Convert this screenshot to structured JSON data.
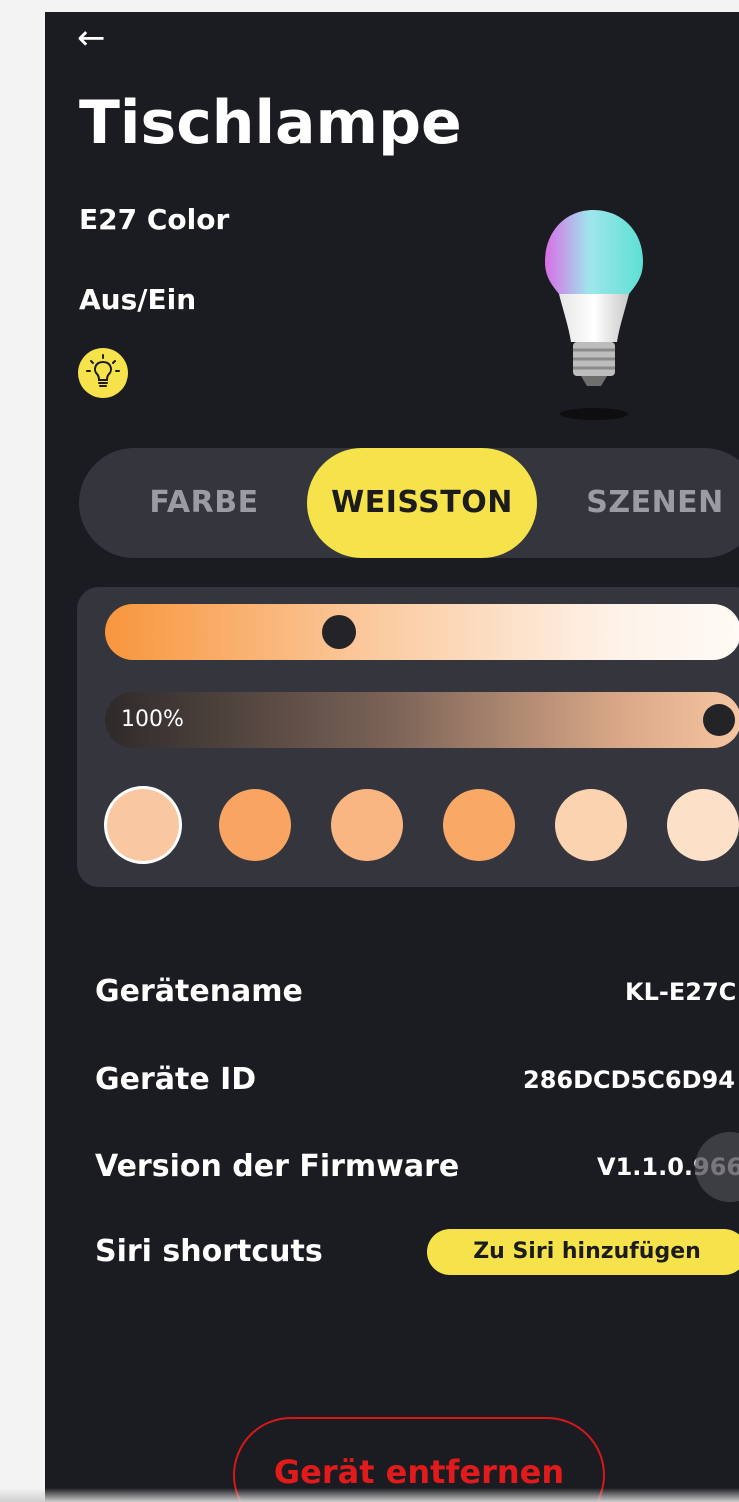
{
  "header": {
    "back_icon": "arrow-left-icon",
    "back_glyph": "←",
    "title": "Tischlampe"
  },
  "device": {
    "model": "E27 Color",
    "image_icon": "light-bulb-image"
  },
  "power": {
    "label": "Aus/Ein",
    "icon": "lightbulb-icon",
    "state": "on",
    "accent": "#f6e24a"
  },
  "tabs": [
    {
      "label": "FARBE",
      "active": false
    },
    {
      "label": "WEISSTON",
      "active": true
    },
    {
      "label": "SZENEN",
      "active": false
    }
  ],
  "white_panel": {
    "temperature_level": 0.36,
    "brightness_label": "100%",
    "brightness_level": 1.0,
    "swatches": [
      "#f9c8a0",
      "#f9a461",
      "#fab681",
      "#f9a866",
      "#fcd3b0",
      "#fde0c8"
    ],
    "selected_swatch": 0
  },
  "info": {
    "device_name_label": "Gerätename",
    "device_name_value": "KL-E27C",
    "device_id_label": "Geräte ID",
    "device_id_value": "286DCD5C6D94",
    "firmware_label": "Version der Firmware",
    "firmware_value": "V1.1.0.966",
    "siri_label": "Siri shortcuts",
    "siri_button": "Zu Siri hinzufügen"
  },
  "remove_button": "Gerät entfernen",
  "colors": {
    "background": "#1b1c21",
    "accent": "#f6e24a",
    "danger": "#e11b1b",
    "panel": "#35363d"
  }
}
